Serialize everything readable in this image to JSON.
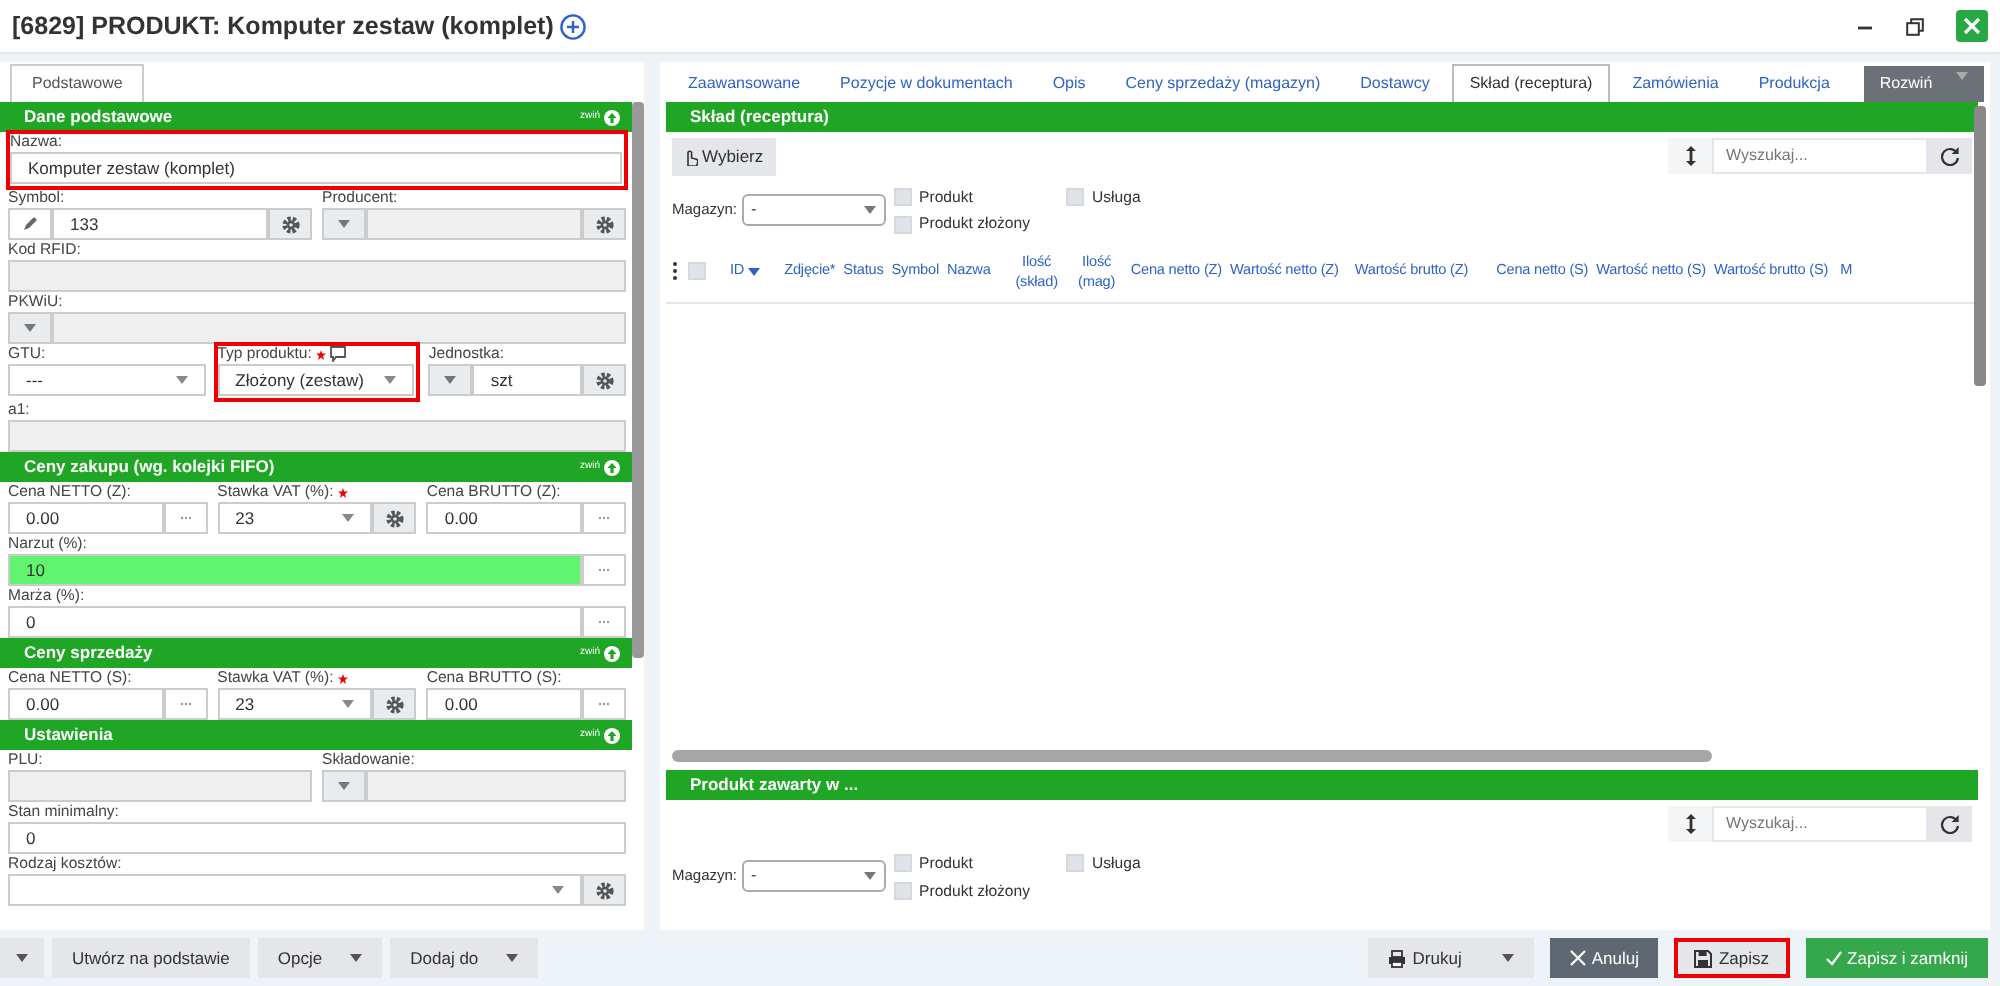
{
  "window": {
    "title": "[6829] PRODUKT: Komputer zestaw (komplet)"
  },
  "left_tabs": [
    {
      "label": "Podstawowe",
      "selected": true
    }
  ],
  "left_sections": [
    {
      "title": "Dane podstawowe",
      "collapse_label": "zwiń",
      "rows": [
        [
          {
            "label": "Nazwa:",
            "kind": "text",
            "value": "Komputer zestaw (komplet)",
            "required": false,
            "disabled": false,
            "highlighted": true,
            "modified": false
          }
        ],
        [
          {
            "label": "Symbol:",
            "kind": "pencil-text-gear",
            "value": "133",
            "required": false,
            "disabled": false,
            "highlighted": false,
            "modified": false
          },
          {
            "label": "Producent:",
            "kind": "caret-text-gear",
            "required": false,
            "disabled": true,
            "highlighted": false,
            "modified": false
          }
        ],
        [
          {
            "label": "Kod RFID:",
            "kind": "text",
            "required": false,
            "disabled": true,
            "highlighted": false,
            "modified": false
          }
        ],
        [
          {
            "label": "PKWiU:",
            "kind": "caret-text",
            "required": false,
            "disabled": true,
            "highlighted": false,
            "modified": false
          }
        ],
        [
          {
            "label": "GTU:",
            "kind": "select",
            "value": "---",
            "required": false,
            "disabled": false,
            "highlighted": false,
            "modified": false
          },
          {
            "label": "Typ produktu:",
            "kind": "select",
            "value": "Złożony (zestaw)",
            "required": true,
            "note_icon": true,
            "disabled": false,
            "highlighted": true,
            "modified": false
          },
          {
            "label": "Jednostka:",
            "kind": "caret-text-gear",
            "value": "szt",
            "required": false,
            "disabled": false,
            "highlighted": false,
            "modified": false
          }
        ],
        [
          {
            "label": "a1:",
            "kind": "text",
            "required": false,
            "disabled": true,
            "highlighted": false,
            "modified": false
          }
        ]
      ]
    },
    {
      "title": "Ceny zakupu (wg. kolejki FIFO)",
      "collapse_label": "zwiń",
      "rows": [
        [
          {
            "label": "Cena NETTO (Z):",
            "kind": "text-dots",
            "value": "0.00",
            "required": false,
            "disabled": false,
            "highlighted": false,
            "modified": false
          },
          {
            "label": "Stawka VAT (%):",
            "kind": "select-gear",
            "value": "23",
            "required": true,
            "disabled": false,
            "highlighted": false,
            "modified": false
          },
          {
            "label": "Cena BRUTTO (Z):",
            "kind": "text-dots",
            "value": "0.00",
            "required": false,
            "disabled": false,
            "highlighted": false,
            "modified": false
          }
        ],
        [
          {
            "label": "Narzut (%):",
            "kind": "text-dots",
            "value": "10",
            "required": false,
            "disabled": false,
            "highlighted": false,
            "modified": true
          }
        ],
        [
          {
            "label": "Marża (%):",
            "kind": "text-dots",
            "value": "0",
            "required": false,
            "disabled": false,
            "highlighted": false,
            "modified": false
          }
        ]
      ]
    },
    {
      "title": "Ceny sprzedaży",
      "collapse_label": "zwiń",
      "rows": [
        [
          {
            "label": "Cena NETTO (S):",
            "kind": "text-dots",
            "value": "0.00",
            "required": false,
            "disabled": false,
            "highlighted": false,
            "modified": false
          },
          {
            "label": "Stawka VAT (%):",
            "kind": "select-gear",
            "value": "23",
            "required": true,
            "disabled": false,
            "highlighted": false,
            "modified": false
          },
          {
            "label": "Cena BRUTTO (S):",
            "kind": "text-dots",
            "value": "0.00",
            "required": false,
            "disabled": false,
            "highlighted": false,
            "modified": false
          }
        ]
      ]
    },
    {
      "title": "Ustawienia",
      "collapse_label": "zwiń",
      "rows": [
        [
          {
            "label": "PLU:",
            "kind": "text",
            "required": false,
            "disabled": true,
            "highlighted": false,
            "modified": false
          },
          {
            "label": "Składowanie:",
            "kind": "caret-text",
            "required": false,
            "disabled": true,
            "highlighted": false,
            "modified": false
          }
        ],
        [
          {
            "label": "Stan minimalny:",
            "kind": "text",
            "value": "0",
            "required": false,
            "disabled": false,
            "highlighted": false,
            "modified": false
          }
        ],
        [
          {
            "label": "Rodzaj kosztów:",
            "kind": "select-gear",
            "required": false,
            "disabled": false,
            "highlighted": false,
            "modified": false
          }
        ]
      ]
    }
  ],
  "right_tabs": [
    {
      "label": "Zaawansowane",
      "kind": "tab",
      "selected": false
    },
    {
      "label": "Pozycje w dokumentach",
      "kind": "tab",
      "selected": false
    },
    {
      "label": "Opis",
      "kind": "tab",
      "selected": false
    },
    {
      "label": "Ceny sprzedaży (magazyn)",
      "kind": "tab",
      "selected": false
    },
    {
      "label": "Dostawcy",
      "kind": "tab",
      "selected": false
    },
    {
      "label": "Skład (receptura)",
      "kind": "tab",
      "selected": true
    },
    {
      "label": "Zamówienia",
      "kind": "tab",
      "selected": false
    },
    {
      "label": "Produkcja",
      "kind": "tab",
      "selected": false
    },
    {
      "label": "Rozwiń",
      "kind": "dropdown",
      "selected": false
    }
  ],
  "composition": {
    "title": "Skład (receptura)",
    "choose_button": "Wybierz",
    "search": {
      "placeholder": "Wyszukaj..."
    },
    "warehouse": {
      "label": "Magazyn:",
      "value": "-"
    },
    "filters": [
      {
        "label": "Produkt",
        "checked": false
      },
      {
        "label": "Usługa",
        "checked": false
      },
      {
        "label": "Produkt złożony",
        "checked": false
      }
    ],
    "select_all": {
      "checked": false
    },
    "columns": [
      {
        "label": "ID",
        "sorted": true
      },
      {
        "label": "Zdjęcie*",
        "sorted": false
      },
      {
        "label": "Status",
        "sorted": false
      },
      {
        "label": "Symbol",
        "sorted": false
      },
      {
        "label": "Nazwa",
        "sorted": false
      },
      {
        "label": "Ilość (skład)",
        "sorted": false
      },
      {
        "label": "Ilość (mag)",
        "sorted": false
      },
      {
        "label": "Cena netto (Z)",
        "sorted": false
      },
      {
        "label": "Wartość netto (Z)",
        "sorted": false
      },
      {
        "label": "Wartość brutto (Z)",
        "sorted": false
      },
      {
        "label": "Cena netto (S)",
        "sorted": false
      },
      {
        "label": "Wartość netto (S)",
        "sorted": false
      },
      {
        "label": "Wartość brutto (S)",
        "sorted": false
      },
      {
        "label": "M",
        "sorted": false
      }
    ]
  },
  "contained_in": {
    "title": "Produkt zawarty w ...",
    "search": {
      "placeholder": "Wyszukaj..."
    },
    "warehouse": {
      "label": "Magazyn:",
      "value": "-"
    },
    "filters": [
      {
        "label": "Produkt",
        "checked": false
      },
      {
        "label": "Usługa",
        "checked": false
      },
      {
        "label": "Produkt złożony",
        "checked": false
      }
    ]
  },
  "footer": {
    "left_buttons": [
      {
        "kind": "caret-only"
      },
      {
        "label": "Utwórz na podstawie",
        "kind": "plain"
      },
      {
        "label": "Opcje",
        "kind": "dropdown"
      },
      {
        "label": "Dodaj do",
        "kind": "dropdown"
      }
    ],
    "right_buttons": [
      {
        "label": "Drukuj",
        "kind": "print",
        "highlighted": false
      },
      {
        "label": "Anuluj",
        "kind": "cancel",
        "highlighted": false
      },
      {
        "label": "Zapisz",
        "kind": "save",
        "highlighted": true
      },
      {
        "label": "Zapisz i zamknij",
        "kind": "save-close",
        "highlighted": false
      }
    ]
  }
}
